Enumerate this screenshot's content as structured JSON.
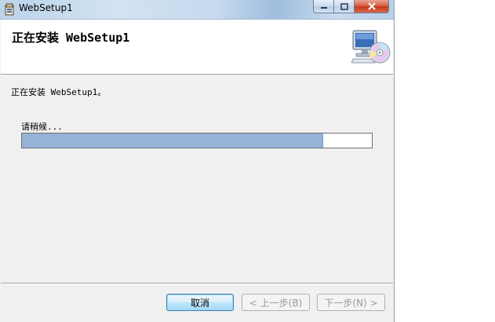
{
  "window": {
    "title": "WebSetup1"
  },
  "banner": {
    "title": "正在安装 WebSetup1"
  },
  "body": {
    "status": "正在安装 WebSetup1。",
    "wait": "请稍候..."
  },
  "progress": {
    "value_percent": 86
  },
  "buttons": {
    "cancel": "取消",
    "back": "< 上一步(B)",
    "next": "下一步(N) >"
  },
  "colors": {
    "progress_fill": "#95b3d7",
    "window_bg": "#f0f0f0"
  },
  "icons": {
    "title": "installer-icon",
    "banner": "computer-cd-icon"
  }
}
